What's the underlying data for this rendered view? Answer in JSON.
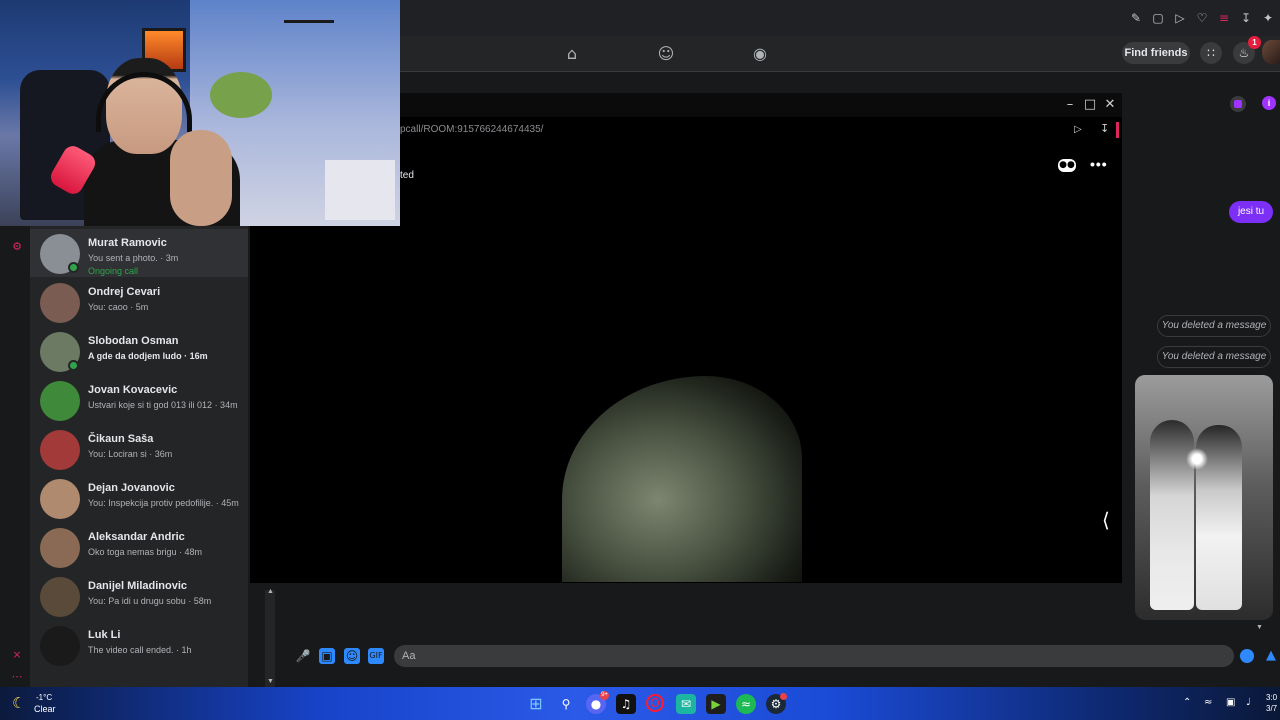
{
  "nav": {
    "find_friends_label": "Find friends",
    "notification_count": "1"
  },
  "call": {
    "url": "pcall/ROOM:915766244674435/",
    "label": "ted"
  },
  "chats": [
    {
      "name": "Murat Ramovic",
      "preview": "You sent a photo. · 3m",
      "status": "Ongoing call",
      "online": true,
      "active": true,
      "avatar_color": "#8a8f96"
    },
    {
      "name": "Ondrej Cevari",
      "preview": "You: caoo · 5m",
      "online": false,
      "avatar_color": "#7a5c52"
    },
    {
      "name": "Slobodan Osman",
      "preview": "A gde da dodjem ludo · 16m",
      "preview_bold": true,
      "online": true,
      "avatar_color": "#6d7a63"
    },
    {
      "name": "Jovan Kovacevic",
      "preview": "Ustvari koje si ti god 013 ili 012 · 34m",
      "online": false,
      "avatar_color": "#3f8a3a"
    },
    {
      "name": "Čikaun Saša",
      "preview": "You: Lociran si · 36m",
      "online": false,
      "avatar_color": "#a33a3a"
    },
    {
      "name": "Dejan Jovanovic",
      "preview": "You: Inspekcija protiv pedofilije. · 45m",
      "online": false,
      "avatar_color": "#b08a6e"
    },
    {
      "name": "Aleksandar Andric",
      "preview": "Oko toga nemas brigu · 48m",
      "online": false,
      "avatar_color": "#8a6a55"
    },
    {
      "name": "Danijel Miladinovic",
      "preview": "You: Pa idi u drugu sobu · 58m",
      "online": false,
      "avatar_color": "#5a4a3a"
    },
    {
      "name": "Luk Li",
      "preview": "The video call ended. · 1h",
      "online": false,
      "avatar_color": "#1a1a1a"
    }
  ],
  "messages": {
    "sent_text": "jesi tu",
    "deleted_1": "You deleted a message",
    "deleted_2": "You deleted a message"
  },
  "composer": {
    "placeholder": "Aa"
  },
  "taskbar": {
    "temperature": "-1°C",
    "weather": "Clear",
    "time": "3:0",
    "date": "3/7",
    "discord_badge": "9+"
  },
  "colors": {
    "accent_purple": "#7b2ff7",
    "online_green": "#31a24c",
    "messenger_blue": "#2e89ff"
  }
}
